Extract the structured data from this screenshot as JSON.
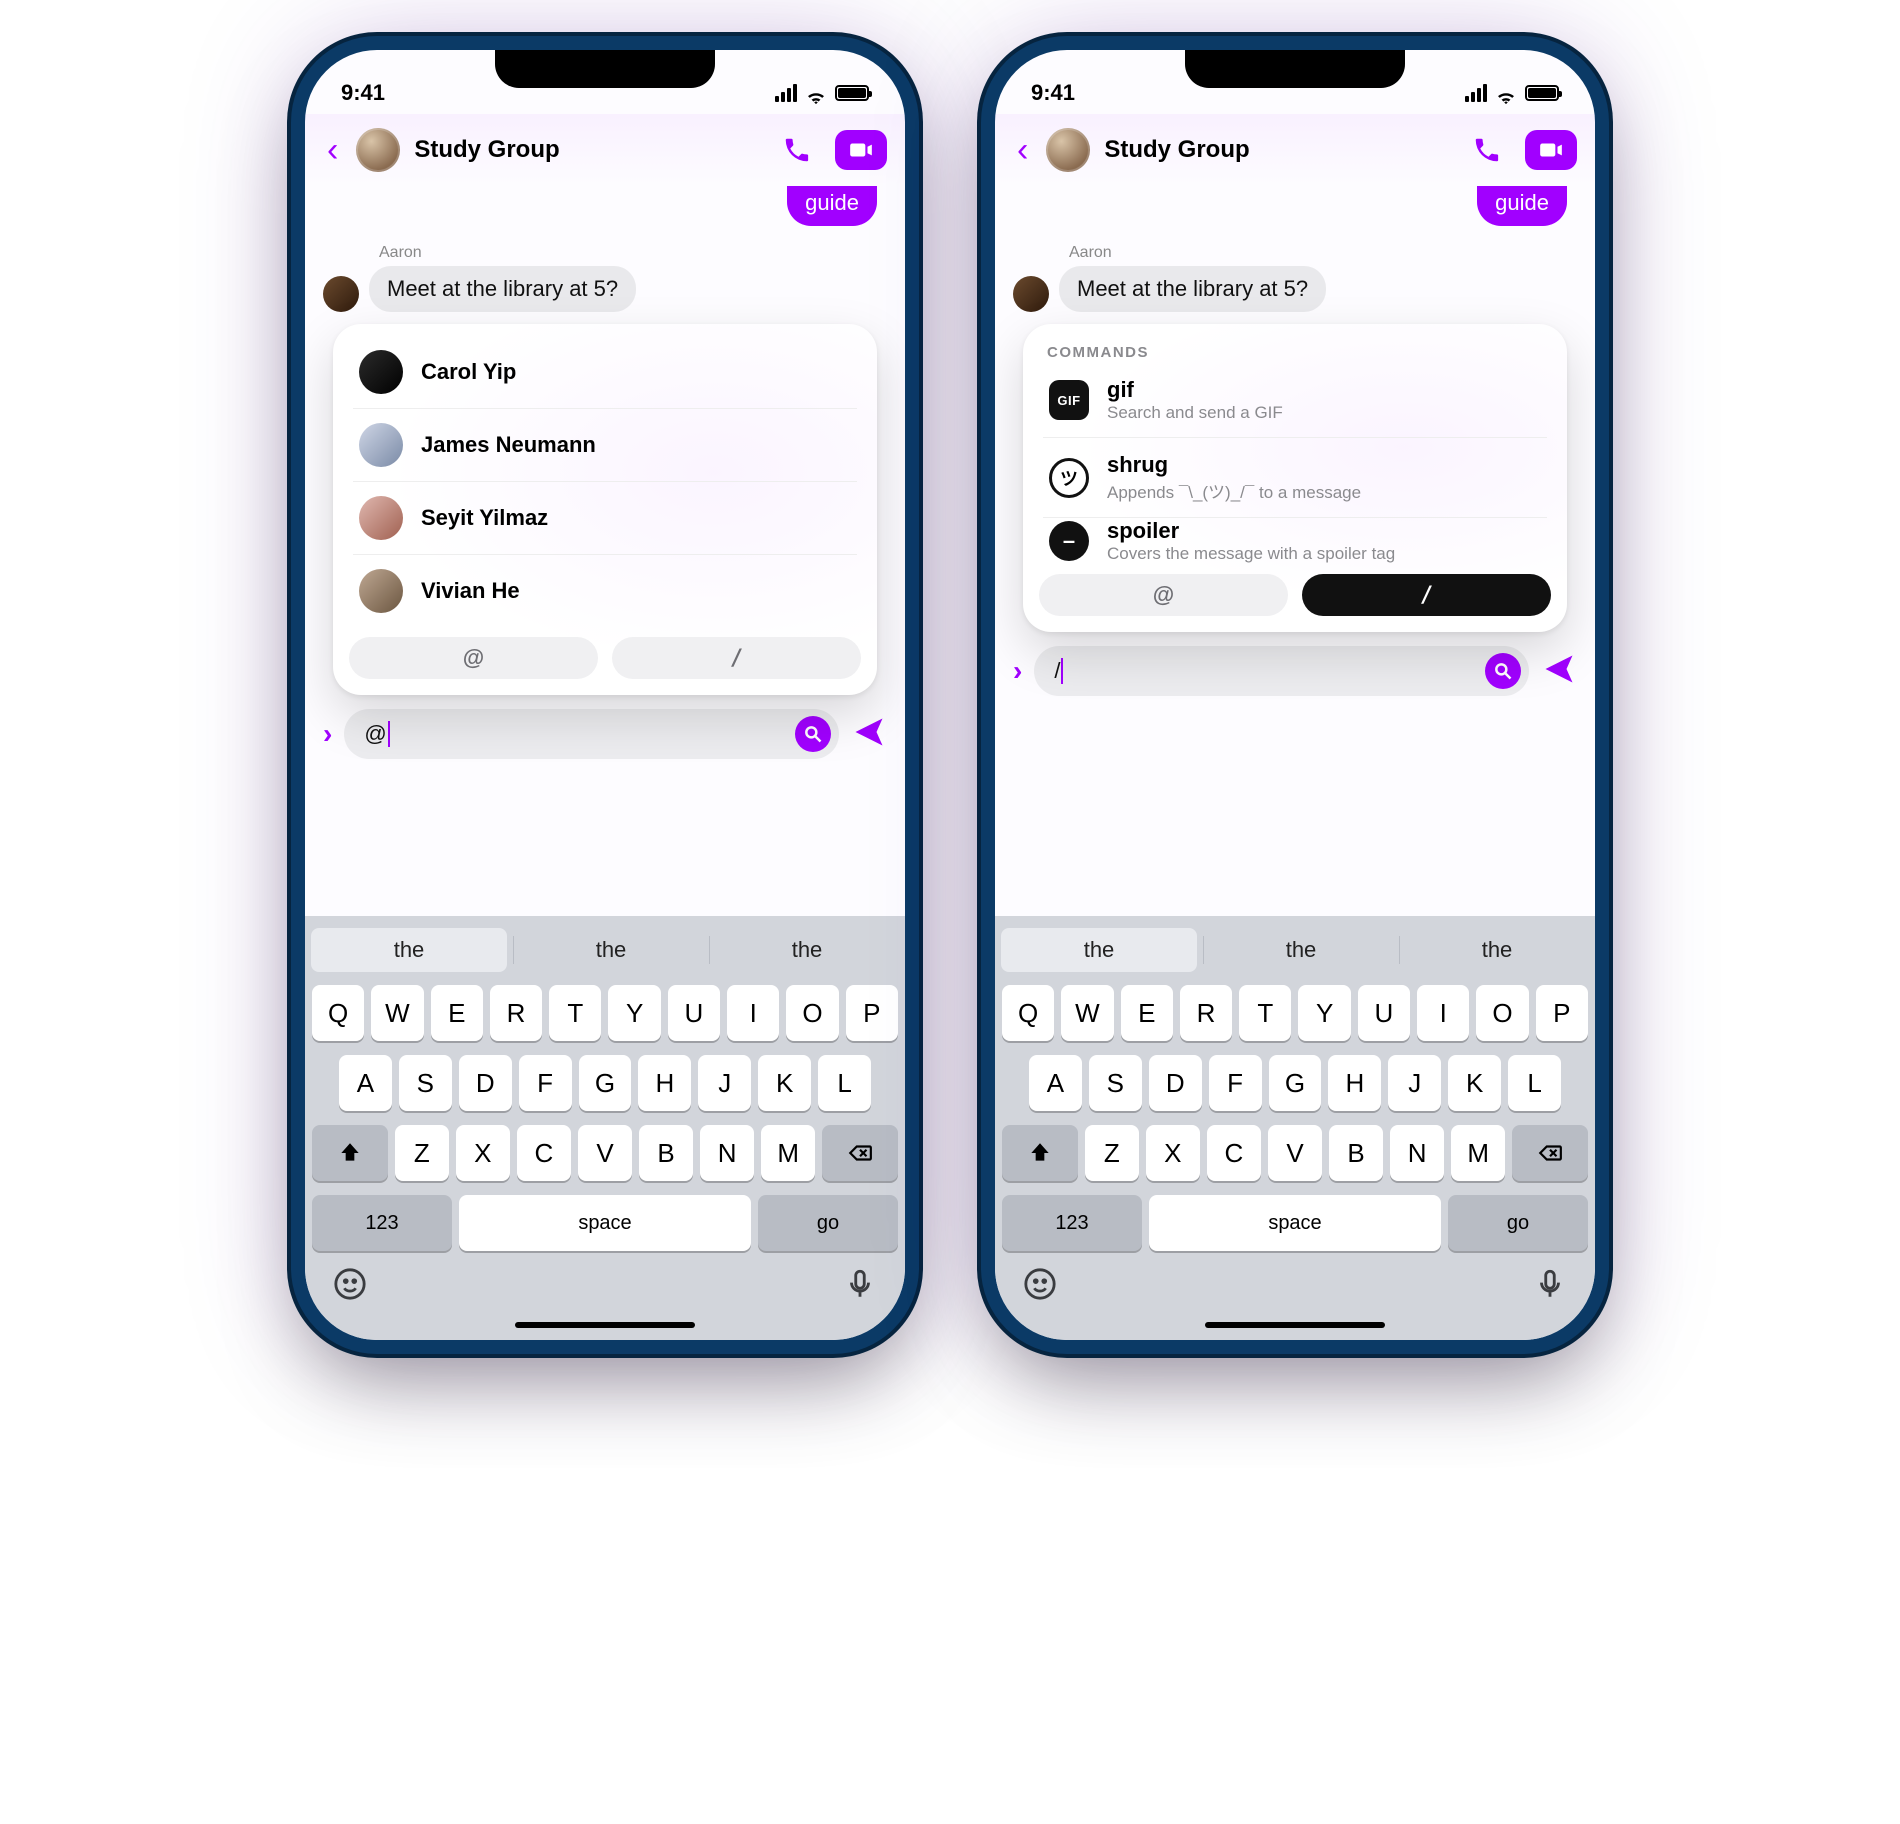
{
  "status": {
    "time": "9:41"
  },
  "header": {
    "title": "Study Group"
  },
  "chat": {
    "outgoing_tail": "guide",
    "sender": "Aaron",
    "incoming": "Meet at the library at 5?"
  },
  "mentions": {
    "people": [
      {
        "name": "Carol Yip"
      },
      {
        "name": "James Neumann"
      },
      {
        "name": "Seyit Yilmaz"
      },
      {
        "name": "Vivian He"
      }
    ],
    "tabs": {
      "at": "@",
      "slash": "/"
    }
  },
  "commands": {
    "section": "COMMANDS",
    "items": [
      {
        "icon": "GIF",
        "title": "gif",
        "sub": "Search and send a GIF"
      },
      {
        "icon": "ツ",
        "title": "shrug",
        "sub": "Appends ¯\\_(ツ)_/¯ to a message"
      },
      {
        "icon": "–",
        "title": "spoiler",
        "sub": "Covers the message with a spoiler tag"
      }
    ]
  },
  "composer": {
    "left_value": "@",
    "right_value": "/"
  },
  "keyboard": {
    "suggestions": [
      "the",
      "the",
      "the"
    ],
    "row1": [
      "Q",
      "W",
      "E",
      "R",
      "T",
      "Y",
      "U",
      "I",
      "O",
      "P"
    ],
    "row2": [
      "A",
      "S",
      "D",
      "F",
      "G",
      "H",
      "J",
      "K",
      "L"
    ],
    "row3": [
      "Z",
      "X",
      "C",
      "V",
      "B",
      "N",
      "M"
    ],
    "numKey": "123",
    "space": "space",
    "go": "go"
  }
}
